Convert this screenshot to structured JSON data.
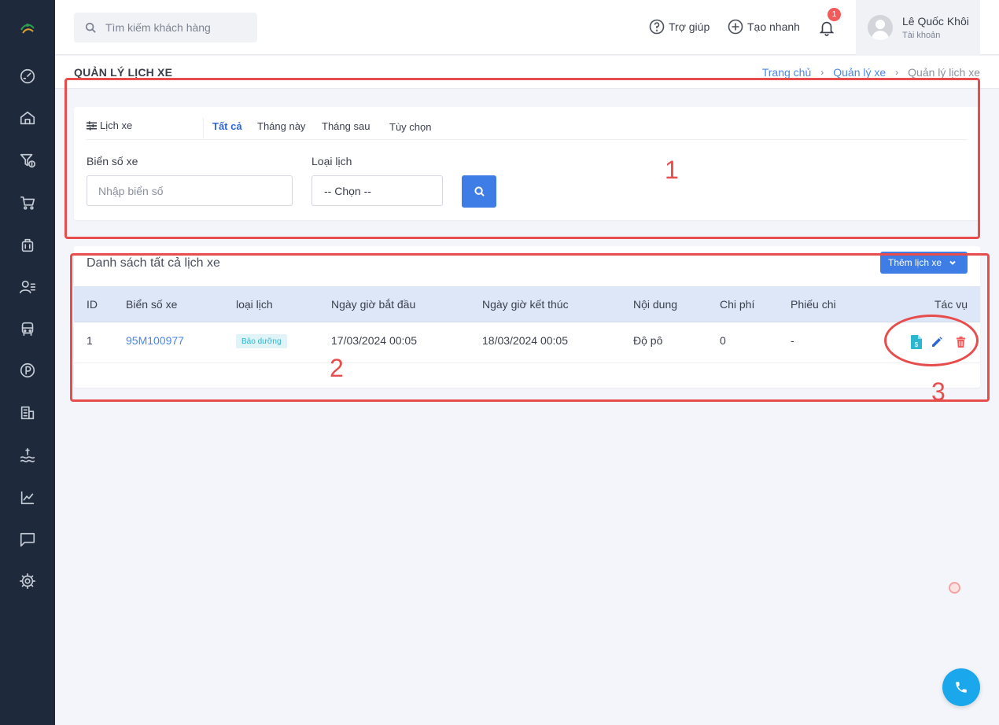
{
  "sidebar": {
    "items": [
      {
        "icon": "dashboard-gauge-icon"
      },
      {
        "icon": "home-icon"
      },
      {
        "icon": "cost-filter-icon"
      },
      {
        "icon": "cart-icon"
      },
      {
        "icon": "briefcase-icon"
      },
      {
        "icon": "staff-list-icon"
      },
      {
        "icon": "vehicle-icon"
      },
      {
        "icon": "parking-icon"
      },
      {
        "icon": "building-icon"
      },
      {
        "icon": "finance-wave-icon"
      },
      {
        "icon": "chart-icon"
      },
      {
        "icon": "message-icon"
      },
      {
        "icon": "settings-gear-icon"
      }
    ]
  },
  "topbar": {
    "search_placeholder": "Tìm kiếm khách hàng",
    "help_label": "Trợ giúp",
    "quick_create_label": "Tạo nhanh",
    "notification_count": "1",
    "user_name": "Lê Quốc Khôi",
    "user_role": "Tài khoản"
  },
  "page": {
    "title": "QUẢN LÝ LỊCH XE",
    "breadcrumb": {
      "home": "Trang chủ",
      "vehicles": "Quản lý xe",
      "current": "Quản lý lịch xe"
    }
  },
  "filter": {
    "lead_label": "Lịch xe",
    "tabs": [
      "Tất cả",
      "Tháng này",
      "Tháng sau",
      "Tùy chọn"
    ],
    "active_tab": 0,
    "plate_label": "Biển số xe",
    "plate_placeholder": "Nhập biển số",
    "type_label": "Loại lịch",
    "type_selected": "-- Chọn --"
  },
  "list": {
    "title": "Danh sách tất cả lịch xe",
    "add_button": "Thêm lịch xe",
    "columns": [
      "ID",
      "Biển số xe",
      "loại lịch",
      "Ngày giờ bắt đầu",
      "Ngày giờ kết thúc",
      "Nội dung",
      "Chi phí",
      "Phiếu chi",
      "Tác vụ"
    ],
    "rows": [
      {
        "id": "1",
        "plate": "95M100977",
        "type": "Bảo dưỡng",
        "start": "17/03/2024 00:05",
        "end": "18/03/2024 00:05",
        "content": "Độ pô",
        "cost": "0",
        "voucher": "-"
      }
    ]
  },
  "annotations": [
    "1",
    "2",
    "3"
  ],
  "colors": {
    "sidebar_bg": "#1e2a3b",
    "primary": "#3f7de6",
    "link": "#4a86e8",
    "table_header": "#dde7f8",
    "annotation_red": "#e84d4d",
    "badge_text": "#2cb6cf",
    "delete_red": "#f05b5b",
    "fab": "#1aa7ec"
  }
}
